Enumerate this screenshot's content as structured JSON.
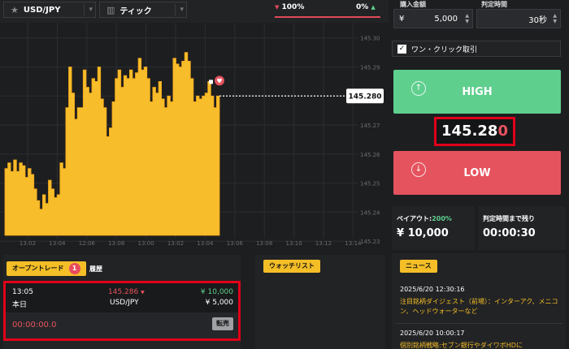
{
  "topbar": {
    "symbol": "USD/JPY",
    "chart_mode": "ティック",
    "high_pct": "100%",
    "low_pct": "0%"
  },
  "chart_data": {
    "type": "area",
    "color": "#f7bd2a",
    "x_ticks": [
      "13:02",
      "13:04",
      "12:06",
      "13:08",
      "13:00",
      "13:02",
      "13:04",
      "13:06",
      "13:08",
      "13:10",
      "13:12",
      "13:14"
    ],
    "y_ticks": [
      "145.23",
      "145.24",
      "145.25",
      "145.26",
      "145.27",
      "145.28",
      "145.29",
      "145.30"
    ],
    "ylim": [
      145.232,
      145.303
    ],
    "current_price": "145.280",
    "values": [
      145.255,
      145.257,
      145.254,
      145.258,
      145.254,
      145.257,
      145.256,
      145.252,
      145.255,
      145.253,
      145.248,
      145.244,
      145.241,
      145.246,
      145.243,
      145.251,
      145.248,
      145.245,
      145.246,
      145.257,
      145.255,
      145.276,
      145.29,
      145.281,
      145.272,
      145.276,
      145.276,
      145.289,
      145.283,
      145.281,
      145.286,
      145.285,
      145.29,
      145.279,
      145.276,
      145.266,
      145.269,
      145.278,
      145.286,
      145.289,
      145.283,
      145.287,
      145.286,
      145.289,
      145.286,
      145.288,
      145.293,
      145.289,
      145.29,
      145.286,
      145.278,
      145.283,
      145.281,
      145.285,
      145.279,
      145.276,
      145.28,
      145.278,
      145.293,
      145.291,
      145.29,
      145.292,
      145.295,
      145.292,
      145.286,
      145.278,
      145.28,
      145.279,
      145.28,
      145.281,
      145.285,
      145.28,
      145.276,
      145.28
    ],
    "grid": true
  },
  "order": {
    "amount_label": "購入金額",
    "currency": "¥",
    "amount": "5,000",
    "time_label": "判定時間",
    "time": "30秒",
    "one_click_label": "ワン・クリック取引",
    "one_click_checked": true,
    "high_label": "HIGH",
    "low_label": "LOW",
    "price_main": "145.28",
    "price_last": "0",
    "payout_label": "ペイアウト:",
    "payout_pct": "200%",
    "payout_value": "¥ 10,000",
    "remaining_label": "判定時間まで残り",
    "remaining_value": "00:00:30"
  },
  "open_trades": {
    "tab_label": "オープントレード",
    "count": "1",
    "history_label": "履歴",
    "trade": {
      "time": "13:05",
      "date": "本日",
      "price": "145.286",
      "price_arrow": "▼",
      "pair": "USD/JPY",
      "payout": "¥ 10,000",
      "amount": "¥ 5,000",
      "timer": "00:00:00.0",
      "sell_label": "転売"
    }
  },
  "watchlist": {
    "label": "ウォッチリスト"
  },
  "news": {
    "label": "ニュース",
    "items": [
      {
        "time": "2025/6/20 12:30:16",
        "title": "注目銘柄ダイジェスト（前場）：インターアク、メニコン、ヘッドウォーターなど"
      },
      {
        "time": "2025/6/20 10:00:17",
        "title": "個別銘柄戦略:セブン銀行やダイワボHDに"
      }
    ]
  },
  "colors": {
    "accent": "#f4be27",
    "high": "#5fcf8e",
    "low": "#e5535e",
    "highlight": "#e0001a"
  }
}
